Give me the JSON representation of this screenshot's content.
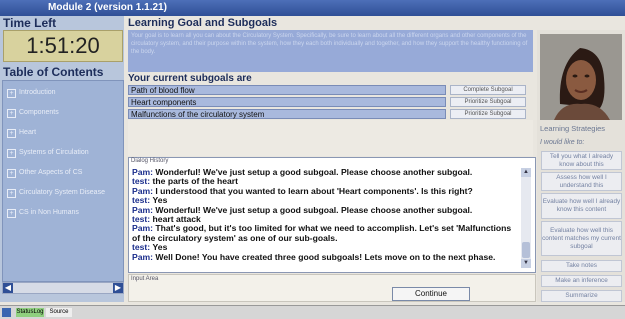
{
  "window": {
    "title": "Module 2 (version 1.1.21)"
  },
  "timer": {
    "label": "Time Left",
    "value": "1:51:20"
  },
  "toc": {
    "label": "Table of Contents",
    "items": [
      {
        "label": "Introduction"
      },
      {
        "label": "Components"
      },
      {
        "label": "Heart"
      },
      {
        "label": "Systems of Circulation"
      },
      {
        "label": "Other Aspects of CS"
      },
      {
        "label": "Circulatory System Disease"
      },
      {
        "label": "CS in Non Humans"
      }
    ]
  },
  "goal": {
    "label": "Learning Goal and Subgoals",
    "text": "Your goal is to learn all you can about the Circulatory System. Specifically, be sure to learn about all the different organs and other components of the circulatory system, and their purpose within the system, how they each both individually and together, and how they support the healthy functioning of the body."
  },
  "subgoals": {
    "label": "Your current subgoals are",
    "items": [
      {
        "name": "Path of blood flow",
        "button": "Complete Subgoal"
      },
      {
        "name": "Heart components",
        "button": "Prioritize Subgoal"
      },
      {
        "name": "Malfunctions of the circulatory system",
        "button": "Prioritize Subgoal"
      }
    ]
  },
  "dialog": {
    "label": "Dialog History",
    "lines": [
      {
        "speaker": "Pam:",
        "text": "Wonderful! We've just setup a good subgoal. Please choose another subgoal.",
        "bold": true
      },
      {
        "speaker": "test:",
        "text": "the parts of the heart",
        "bold": true
      },
      {
        "speaker": "Pam:",
        "text": "I understood that you wanted to learn about 'Heart components'. Is this right?",
        "bold": true
      },
      {
        "speaker": "test:",
        "text": "Yes",
        "bold": true
      },
      {
        "speaker": "Pam:",
        "text": "Wonderful! We've just setup a good subgoal. Please choose another subgoal.",
        "bold": true
      },
      {
        "speaker": "test:",
        "text": "heart attack",
        "bold": true
      },
      {
        "speaker": "Pam:",
        "text": "That's good, but it's too limited for what we need to accomplish. Let's set 'Malfunctions of the circulatory system' as one of our sub-goals.",
        "bold": true
      },
      {
        "speaker": "test:",
        "text": "Yes",
        "bold": true
      },
      {
        "speaker": "Pam:",
        "text": "Well Done! You have created three good subgoals! Lets move on to the next phase.",
        "bold": true
      }
    ]
  },
  "input": {
    "label": "Input Area",
    "continue_label": "Continue"
  },
  "strategies": {
    "label": "Learning Strategies",
    "sublabel": "I would like to:",
    "buttons": [
      "Tell you what I already know about this",
      "Assess how well I understand this",
      "Evaluate how well I already know this content",
      "Evaluate how well this content matches my current subgoal",
      "Take notes",
      "Make an inference",
      "Summarize"
    ]
  },
  "taskbar": {
    "item1": "StatusLog",
    "item2": "Source"
  },
  "colors": {
    "accent": "#2f4f96",
    "panel": "#9fb3d6",
    "timer_bg": "#d8d29e"
  }
}
